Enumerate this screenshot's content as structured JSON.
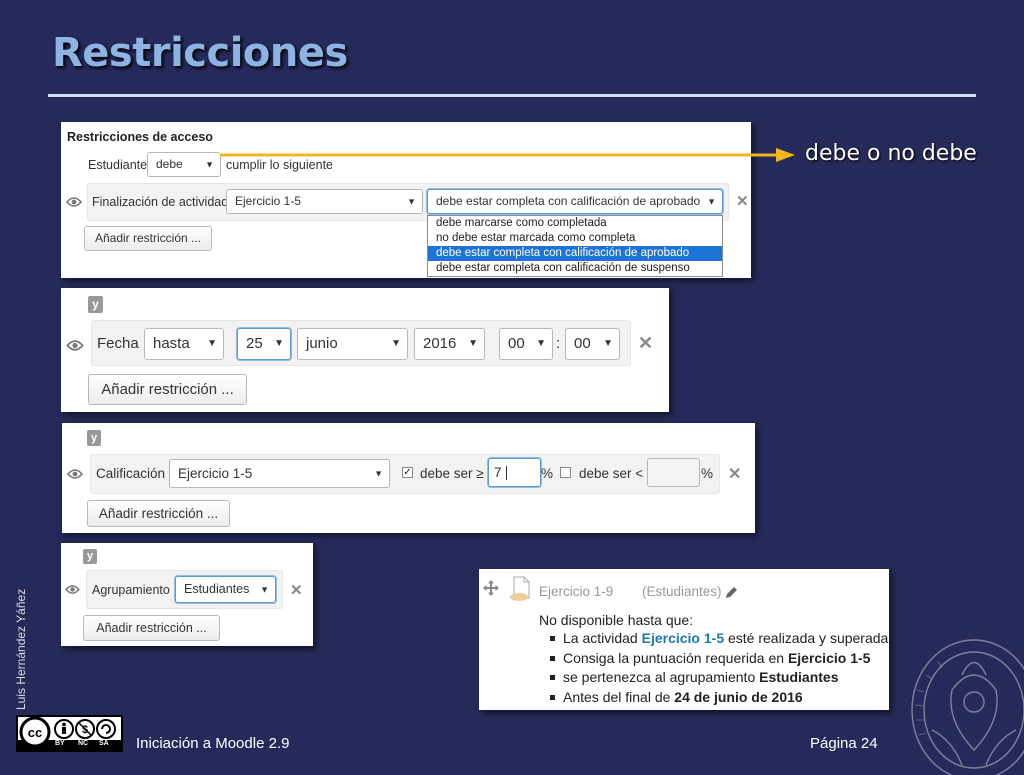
{
  "slide": {
    "title": "Restricciones",
    "callout": "debe o no debe",
    "author": "Luis Hernández Yáñez",
    "footer_left": "Iniciación a Moodle 2.9",
    "footer_right": "Página 24",
    "license": {
      "by": "BY",
      "nc": "NC",
      "sa": "SA"
    }
  },
  "panel1": {
    "heading": "Restricciones de acceso",
    "student_label": "Estudiante",
    "student_select": "debe",
    "student_suffix": "cumplir lo siguiente",
    "condition_label": "Finalización de actividad",
    "activity_select": "Ejercicio 1-5",
    "status_select": "debe estar completa con calificación de aprobado",
    "dropdown_options": [
      "debe marcarse como completada",
      "no debe estar marcada como completa",
      "debe estar completa con calificación de aprobado",
      "debe estar completa con calificación de suspenso"
    ],
    "add_button": "Añadir restricción ..."
  },
  "panel2": {
    "y_tag": "y",
    "label": "Fecha",
    "direction": "hasta",
    "day": "25",
    "month": "junio",
    "year": "2016",
    "hour": "00",
    "minute": "00",
    "colon": ":",
    "add_button": "Añadir restricción ..."
  },
  "panel3": {
    "y_tag": "y",
    "label": "Calificación",
    "activity": "Ejercicio 1-5",
    "min_label": "debe ser ≥",
    "min_value": "7",
    "pct1": "%",
    "max_label": "debe ser <",
    "max_value": "",
    "pct2": "%",
    "add_button": "Añadir restricción ..."
  },
  "panel4": {
    "y_tag": "y",
    "label": "Agrupamiento",
    "group": "Estudiantes",
    "add_button": "Añadir restricción ..."
  },
  "summary": {
    "activity": "Ejercicio 1-9",
    "group": "(Estudiantes)",
    "intro": "No disponible hasta que:",
    "items": [
      {
        "pre": "La actividad ",
        "link": "Ejercicio 1-5",
        "post": " esté realizada y superada"
      },
      {
        "pre": "Consiga la puntuación requerida en ",
        "bold": "Ejercicio 1-5"
      },
      {
        "pre": "se pertenezca al agrupamiento ",
        "bold": "Estudiantes"
      },
      {
        "pre": "Antes del final de ",
        "bold": "24 de junio de 2016"
      }
    ]
  }
}
